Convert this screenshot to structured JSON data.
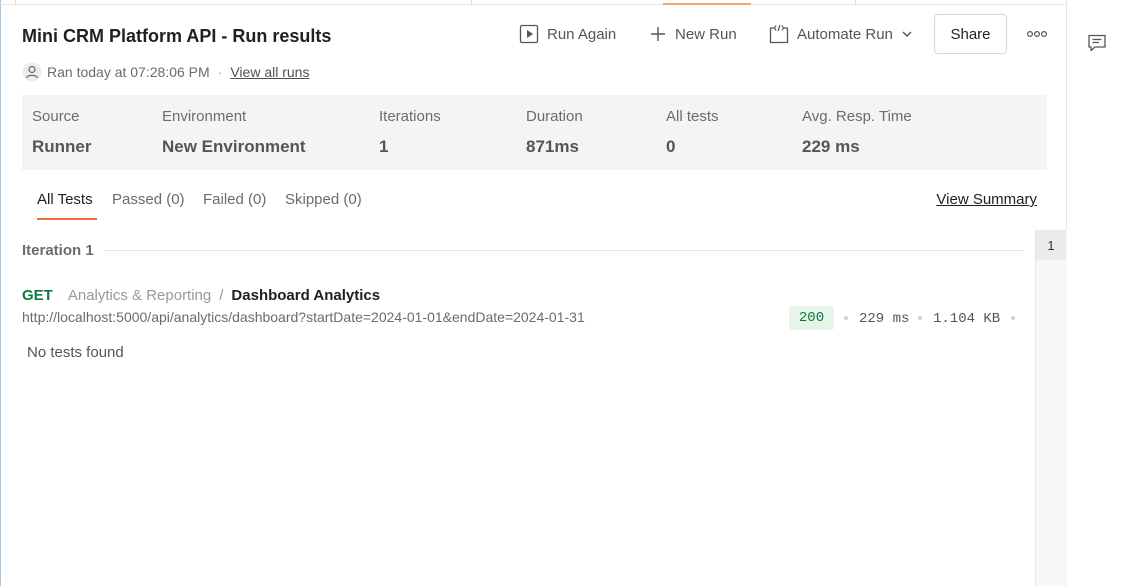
{
  "header": {
    "title": "Mini CRM Platform API - Run results",
    "run_again": "Run Again",
    "new_run": "New Run",
    "automate_run": "Automate Run",
    "share": "Share",
    "ran_at": "Ran today at 07:28:06 PM",
    "separator": "·",
    "view_all_runs": "View all runs"
  },
  "summary": [
    {
      "label": "Source",
      "value": "Runner"
    },
    {
      "label": "Environment",
      "value": "New Environment"
    },
    {
      "label": "Iterations",
      "value": "1"
    },
    {
      "label": "Duration",
      "value": "871ms"
    },
    {
      "label": "All tests",
      "value": "0"
    },
    {
      "label": "Avg. Resp. Time",
      "value": "229 ms"
    }
  ],
  "tabs": [
    {
      "label": "All Tests"
    },
    {
      "label": "Passed (0)"
    },
    {
      "label": "Failed (0)"
    },
    {
      "label": "Skipped (0)"
    }
  ],
  "view_summary": "View Summary",
  "iteration": {
    "label": "Iteration 1",
    "nav_number": "1"
  },
  "request": {
    "method": "GET",
    "folder": "Analytics & Reporting",
    "separator": "/",
    "name": "Dashboard Analytics",
    "url": "http://localhost:5000/api/analytics/dashboard?startDate=2024-01-01&endDate=2024-01-31",
    "status": "200",
    "time": "229 ms",
    "size": "1.104 KB",
    "no_tests": "No tests found"
  },
  "colors": {
    "accent": "#f26b3a",
    "method_get": "#0c7a3e",
    "status_ok_bg": "#e6f4ea"
  },
  "icons": {
    "run_again": "play-icon",
    "new_run": "plus-icon",
    "automate_run": "code-icon",
    "more": "more-icon",
    "ran_by": "user-icon",
    "comments": "comment-icon"
  }
}
